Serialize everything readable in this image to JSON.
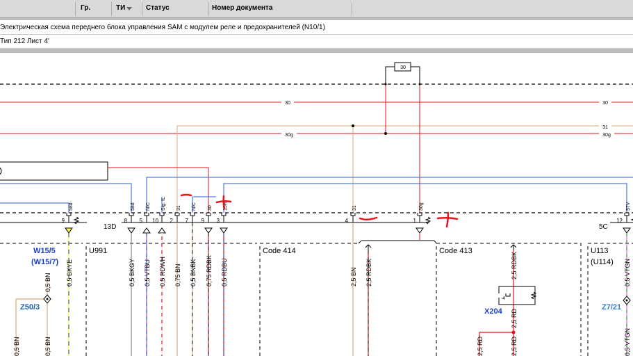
{
  "header": {
    "columns": [
      "Гр.",
      "ТИ",
      "Статус",
      "Номер документа"
    ],
    "sort_icon": "triangle-down-icon"
  },
  "document": {
    "title": "Электрическая схема переднего блока управления SAM с модулем реле и предохранителей (N10/1)",
    "sheet": "Тип 212 Лист 4'"
  },
  "diagram": {
    "bus_labels": [
      "30",
      "30",
      "30g",
      "30g",
      "31"
    ],
    "fuse_label": "30",
    "connector_pins": [
      "58d",
      "58d",
      "N/C",
      "Sig. IL",
      "31",
      "N/C",
      "30",
      "15R",
      "31",
      "30g",
      "57V"
    ],
    "pin_numbers": [
      "9",
      "8",
      "5",
      "10",
      "2",
      "7",
      "9",
      "3",
      "4",
      "1",
      "12"
    ],
    "connector_labels": [
      "13D",
      "5C"
    ],
    "module_labels": [
      "W15/5",
      "(W15/7)",
      "U991",
      "Code 414",
      "Code 413",
      "U113",
      "(U114)"
    ],
    "ground_labels": [
      "Z50/3",
      "X204",
      "Z7/21"
    ],
    "wire_labels": [
      "0,5 BN",
      "0,5 BN",
      "0,5 BN",
      "0,5 BKYE",
      "0,5 BKGY",
      "0,5 VTBU",
      "0,5 RDWH",
      "0,75 BN",
      "0,5 BNBK",
      "0,75 RDBK",
      "0,5 RDBU",
      "2,5 BN",
      "2,5 RDBK",
      "2,5 RDBK",
      "2,5 RD",
      "2,5 RD",
      "2,5 RD",
      "0,5 VTGN",
      "0,5 VTGN"
    ],
    "x204_pin": "4",
    "annotations": [
      "−",
      "+",
      "−",
      "+"
    ],
    "colors": {
      "red": "#e0101a",
      "blue": "#2a5fe0",
      "brown": "#d9a878",
      "label_blue": "#1a3fd0",
      "ground_label_blue": "#2c7dd4",
      "z50_label": "#1a5fb0",
      "annotation_red": "#e8141c"
    }
  }
}
